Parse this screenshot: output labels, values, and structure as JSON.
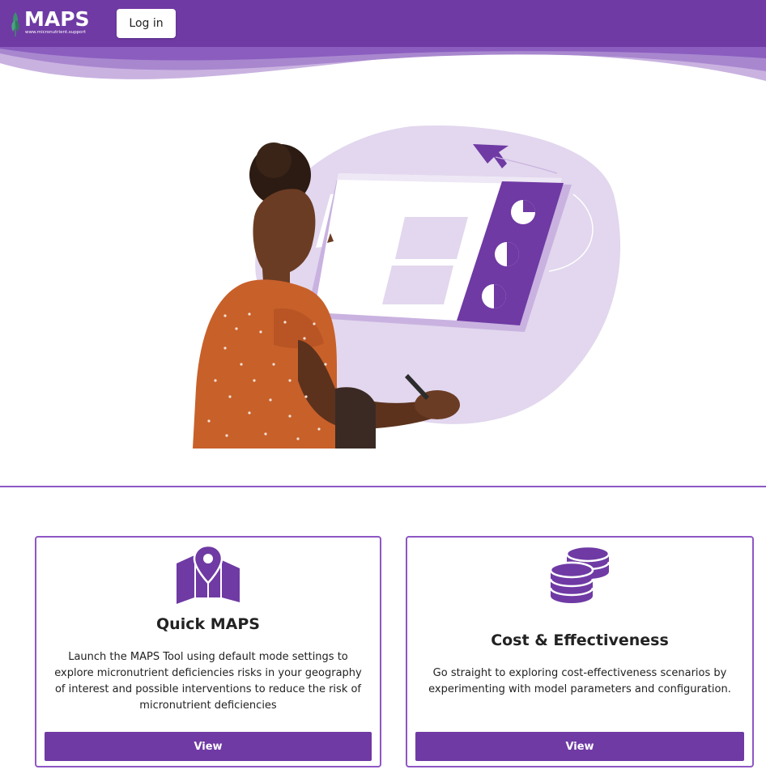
{
  "header": {
    "logo_text": "MAPS",
    "logo_subtext": "www.micronutrient.support",
    "login_label": "Log in"
  },
  "colors": {
    "brand_purple": "#6f3aa4",
    "light_purple": "#e2d7ee",
    "border_purple": "#8e57c4"
  },
  "cards": [
    {
      "icon": "map-pin-icon",
      "title": "Quick MAPS",
      "description": "Launch the MAPS Tool using default mode settings to explore micronutrient deficiencies risks in your geography of interest and possible interventions to reduce the risk of micronutrient deficiencies",
      "button_label": "View"
    },
    {
      "icon": "coins-icon",
      "title": "Cost & Effectiveness",
      "description": "Go straight to exploring cost-effectiveness scenarios by experimenting with model parameters and configuration.",
      "button_label": "View"
    }
  ]
}
